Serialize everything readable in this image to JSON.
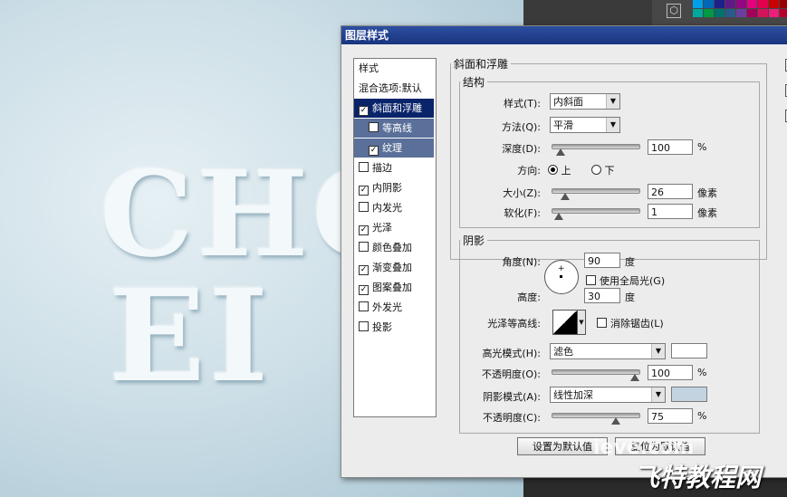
{
  "canvas_text": {
    "line1": "CHO",
    "line2": "EI"
  },
  "colors": {
    "title_bar": "#1a3580",
    "selected": "#0a246a",
    "sub_item": "#5a6f99",
    "highlight_swatch": "#ffffff",
    "shadow_swatch": "#c3d4e0"
  },
  "dialog": {
    "title": "图层样式",
    "styles_header": "样式",
    "blend_options": "混合选项:默认",
    "items": [
      {
        "label": "斜面和浮雕",
        "checked": true
      },
      {
        "label": "等高线",
        "checked": false
      },
      {
        "label": "纹理",
        "checked": true
      },
      {
        "label": "描边",
        "checked": false
      },
      {
        "label": "内阴影",
        "checked": true
      },
      {
        "label": "内发光",
        "checked": false
      },
      {
        "label": "光泽",
        "checked": true
      },
      {
        "label": "颜色叠加",
        "checked": false
      },
      {
        "label": "渐变叠加",
        "checked": true
      },
      {
        "label": "图案叠加",
        "checked": true
      },
      {
        "label": "外发光",
        "checked": false
      },
      {
        "label": "投影",
        "checked": false
      }
    ]
  },
  "bevel": {
    "group_title": "斜面和浮雕",
    "structure_title": "结构",
    "style_label": "样式(T):",
    "style_value": "内斜面",
    "technique_label": "方法(Q):",
    "technique_value": "平滑",
    "depth_label": "深度(D):",
    "depth_value": "100",
    "depth_unit": "%",
    "direction_label": "方向:",
    "direction_up": "上",
    "direction_down": "下",
    "direction_selected": "上",
    "size_label": "大小(Z):",
    "size_value": "26",
    "size_unit": "像素",
    "soften_label": "软化(F):",
    "soften_value": "1",
    "soften_unit": "像素",
    "depth_slider": 0.05,
    "size_slider": 0.1,
    "soften_slider": 0.02
  },
  "shading": {
    "title": "阴影",
    "angle_label": "角度(N):",
    "angle_value": "90",
    "angle_unit": "度",
    "global_light_label": "使用全局光(G)",
    "global_light_checked": false,
    "altitude_label": "高度:",
    "altitude_value": "30",
    "altitude_unit": "度",
    "gloss_label": "光泽等高线:",
    "anti_alias_label": "消除锯齿(L)",
    "anti_alias_checked": false,
    "highlight_mode_label": "高光模式(H):",
    "highlight_mode_value": "滤色",
    "highlight_opacity_label": "不透明度(O):",
    "highlight_opacity_value": "100",
    "highlight_opacity_unit": "%",
    "highlight_slider": 1.0,
    "shadow_mode_label": "阴影模式(A):",
    "shadow_mode_value": "线性加深",
    "shadow_opacity_label": "不透明度(C):",
    "shadow_opacity_value": "75",
    "shadow_opacity_unit": "%",
    "shadow_slider": 0.75
  },
  "buttons": {
    "make_default": "设置为默认值",
    "reset_default": "复位为默认值"
  },
  "watermark": {
    "site": "ieve.com",
    "logo": "飞特教程网"
  }
}
